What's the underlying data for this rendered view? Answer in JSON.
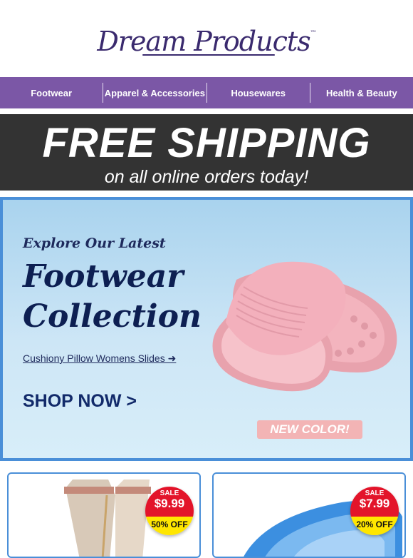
{
  "brand": {
    "name": "Dream Products",
    "trademark": "™"
  },
  "nav": {
    "items": [
      "Footwear",
      "Apparel & Accessories",
      "Housewares",
      "Health & Beauty"
    ]
  },
  "banner": {
    "headline": "FREE SHIPPING",
    "subline": "on all online orders today!"
  },
  "hero": {
    "pretitle": "Explore Our Latest",
    "title_line1": "Footwear",
    "title_line2": "Collection",
    "product_link": "Cushiony Pillow Womens Slides ➜",
    "cta": "SHOP NOW >",
    "badge": "NEW COLOR!"
  },
  "products": [
    {
      "sale_label": "SALE",
      "price": "$9.99",
      "discount": "50% OFF"
    },
    {
      "sale_label": "SALE",
      "price": "$7.99",
      "discount": "20% OFF"
    }
  ],
  "colors": {
    "brand": "#3a2a6e",
    "nav_bg": "#7b57a6",
    "banner_bg": "#333333",
    "hero_border": "#4a8fd8",
    "sale_red": "#e3142a",
    "sale_yellow": "#ffe600",
    "slide_pink": "#f3b4be"
  }
}
